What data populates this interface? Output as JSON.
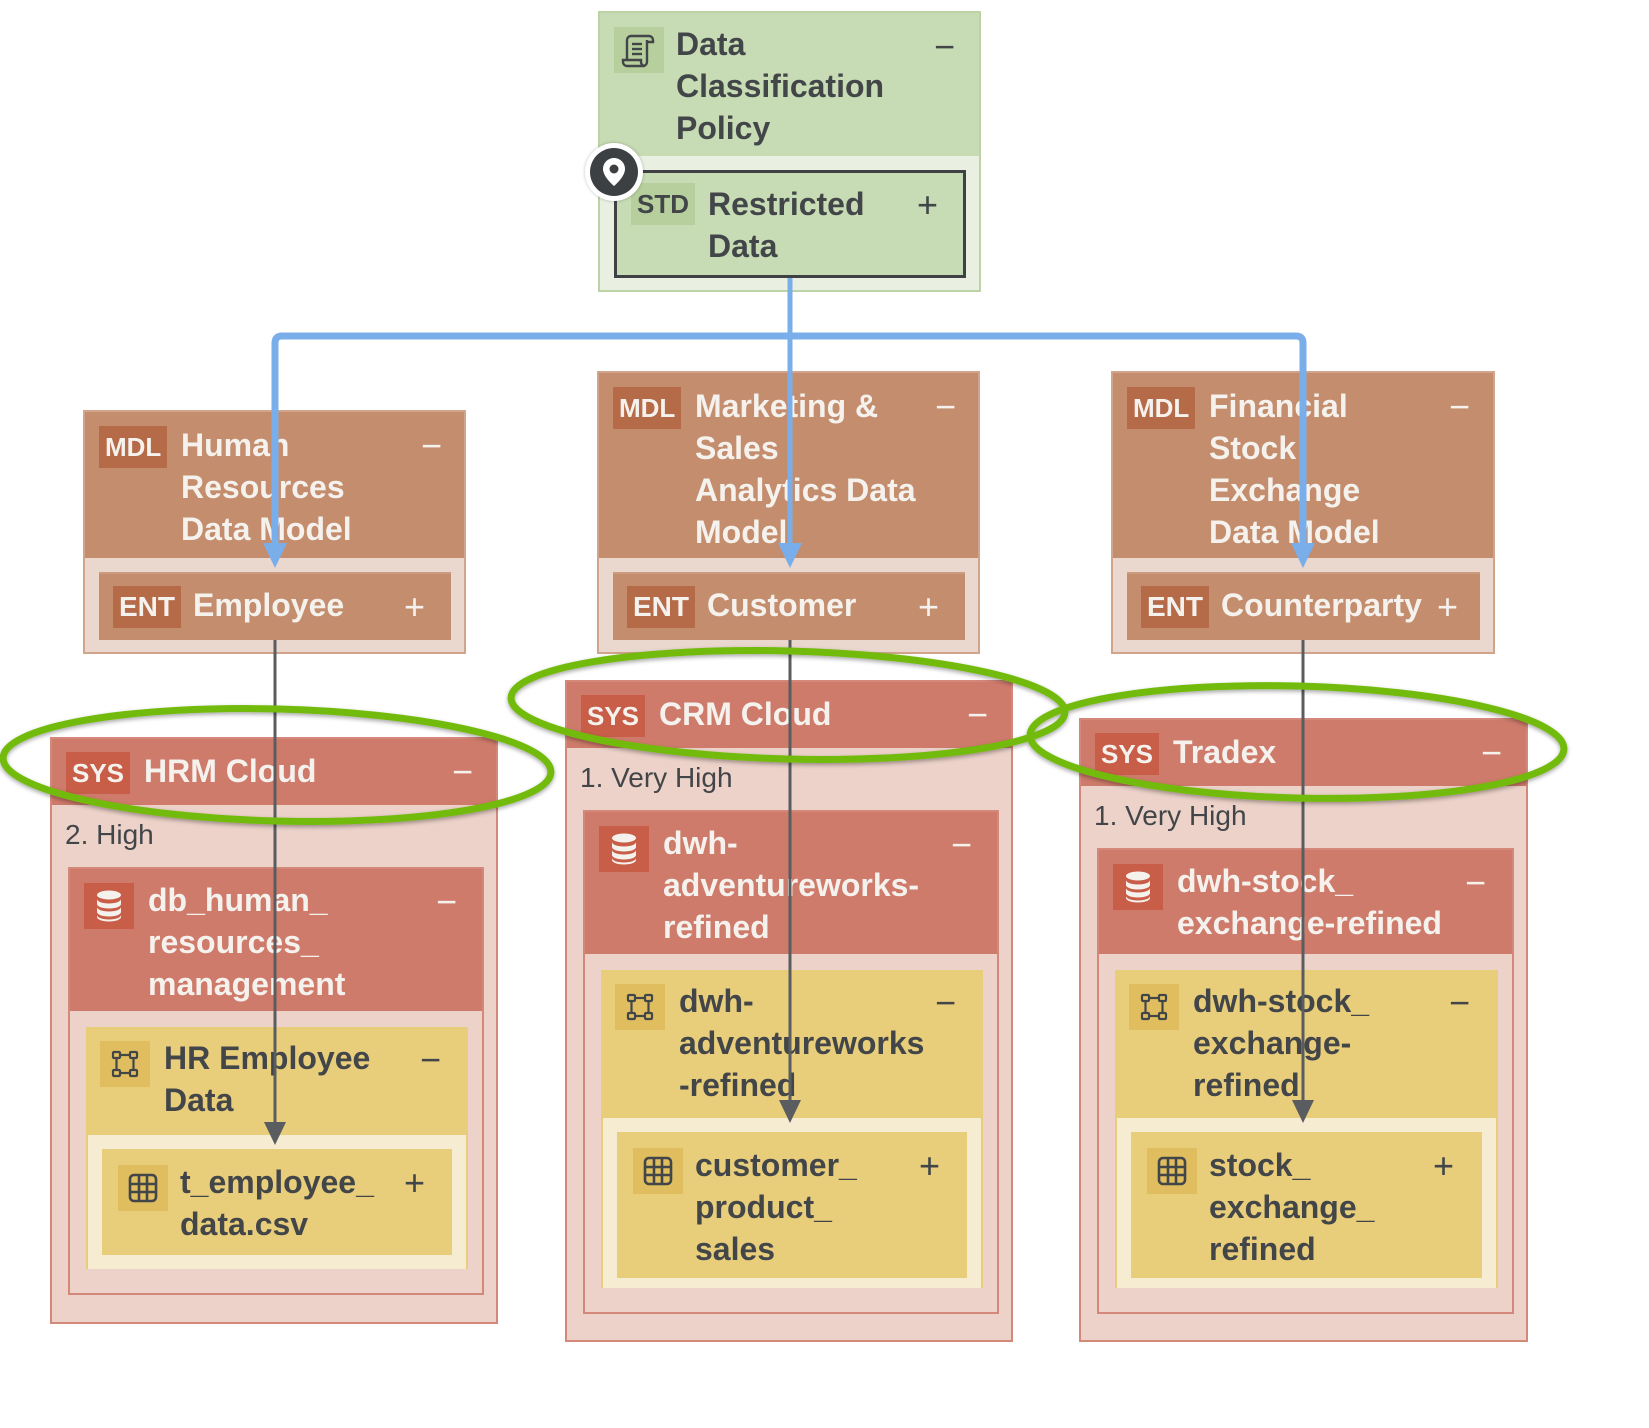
{
  "colors": {
    "policy_bg": "#c7dbb4",
    "policy_inner": "#e9f0e2",
    "model_bg": "#c48d6e",
    "model_inner": "#ead8cf",
    "badge_brown": "#b56a48",
    "system_bg": "#cf7b6b",
    "system_container": "#ecd2c9",
    "badge_red": "#c85e48",
    "dataset_bg": "#e8cd7b",
    "dataset_inner": "#f5ecd2",
    "lineage_blue": "#7aaeea",
    "lineage_gray": "#5a5d60",
    "highlight_green": "#72bb0a"
  },
  "policy": {
    "icon": "policy-scroll-icon",
    "title": "Data\nClassification\nPolicy",
    "toggle": "−",
    "location_icon": "map-pin-icon",
    "standard": {
      "badge": "STD",
      "title": "Restricted\nData",
      "toggle": "+"
    }
  },
  "models": [
    {
      "badge": "MDL",
      "title": "Human\nResources\nData Model",
      "toggle": "−",
      "entity": {
        "badge": "ENT",
        "title": "Employee",
        "toggle": "+"
      }
    },
    {
      "badge": "MDL",
      "title": "Marketing &\nSales\nAnalytics Data\nModel",
      "toggle": "−",
      "entity": {
        "badge": "ENT",
        "title": "Customer",
        "toggle": "+"
      }
    },
    {
      "badge": "MDL",
      "title": "Financial\nStock\nExchange\nData Model",
      "toggle": "−",
      "entity": {
        "badge": "ENT",
        "title": "Counterparty",
        "toggle": "+"
      }
    }
  ],
  "systems": [
    {
      "badge": "SYS",
      "title": "HRM Cloud",
      "toggle": "−",
      "criticality": "2. High",
      "database": {
        "icon": "database-icon",
        "title": "db_human_\nresources_\nmanagement",
        "toggle": "−"
      },
      "dataset": {
        "icon": "schema-icon",
        "title": "HR Employee\nData",
        "toggle": "−"
      },
      "table": {
        "icon": "table-icon",
        "title": "t_employee_\ndata.csv",
        "toggle": "+"
      }
    },
    {
      "badge": "SYS",
      "title": "CRM Cloud",
      "toggle": "−",
      "criticality": "1. Very High",
      "database": {
        "icon": "database-icon",
        "title": "dwh-\nadventureworks-\nrefined",
        "toggle": "−"
      },
      "dataset": {
        "icon": "schema-icon",
        "title": "dwh-\nadventureworks\n-refined",
        "toggle": "−"
      },
      "table": {
        "icon": "table-icon",
        "title": "customer_\nproduct_\nsales",
        "toggle": "+"
      }
    },
    {
      "badge": "SYS",
      "title": "Tradex",
      "toggle": "−",
      "criticality": "1. Very High",
      "database": {
        "icon": "database-icon",
        "title": "dwh-stock_\nexchange-refined",
        "toggle": "−"
      },
      "dataset": {
        "icon": "schema-icon",
        "title": "dwh-stock_\nexchange-\nrefined",
        "toggle": "−"
      },
      "table": {
        "icon": "table-icon",
        "title": "stock_\nexchange_\nrefined",
        "toggle": "+"
      }
    }
  ]
}
